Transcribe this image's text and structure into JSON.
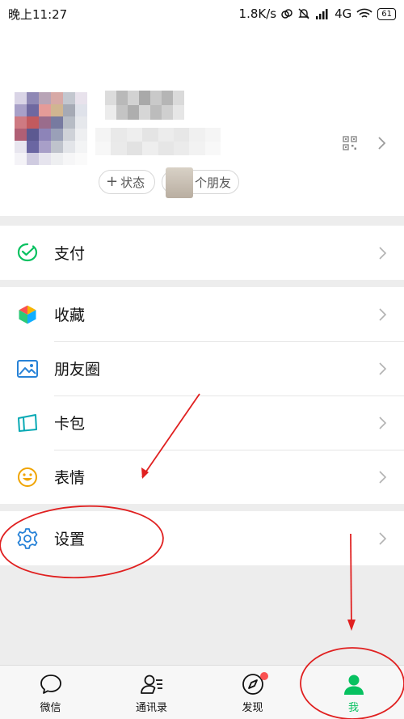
{
  "status_bar": {
    "time": "晚上11:27",
    "speed": "1.8K/s",
    "network": "4G",
    "battery": "61"
  },
  "profile": {
    "status_button": "状态",
    "friends_button": "个朋友"
  },
  "menu": {
    "pay": "支付",
    "favorites": "收藏",
    "moments": "朋友圈",
    "cards": "卡包",
    "stickers": "表情",
    "settings": "设置"
  },
  "tabbar": {
    "chats": "微信",
    "contacts": "通讯录",
    "discover": "发现",
    "me": "我"
  },
  "colors": {
    "accent": "#07c160",
    "annotation": "#e02020",
    "badge": "#fa5151"
  },
  "icons": [
    "pay-icon",
    "favorites-icon",
    "moments-icon",
    "cards-icon",
    "stickers-icon",
    "settings-icon",
    "qr-code-icon",
    "chevron-right-icon"
  ]
}
